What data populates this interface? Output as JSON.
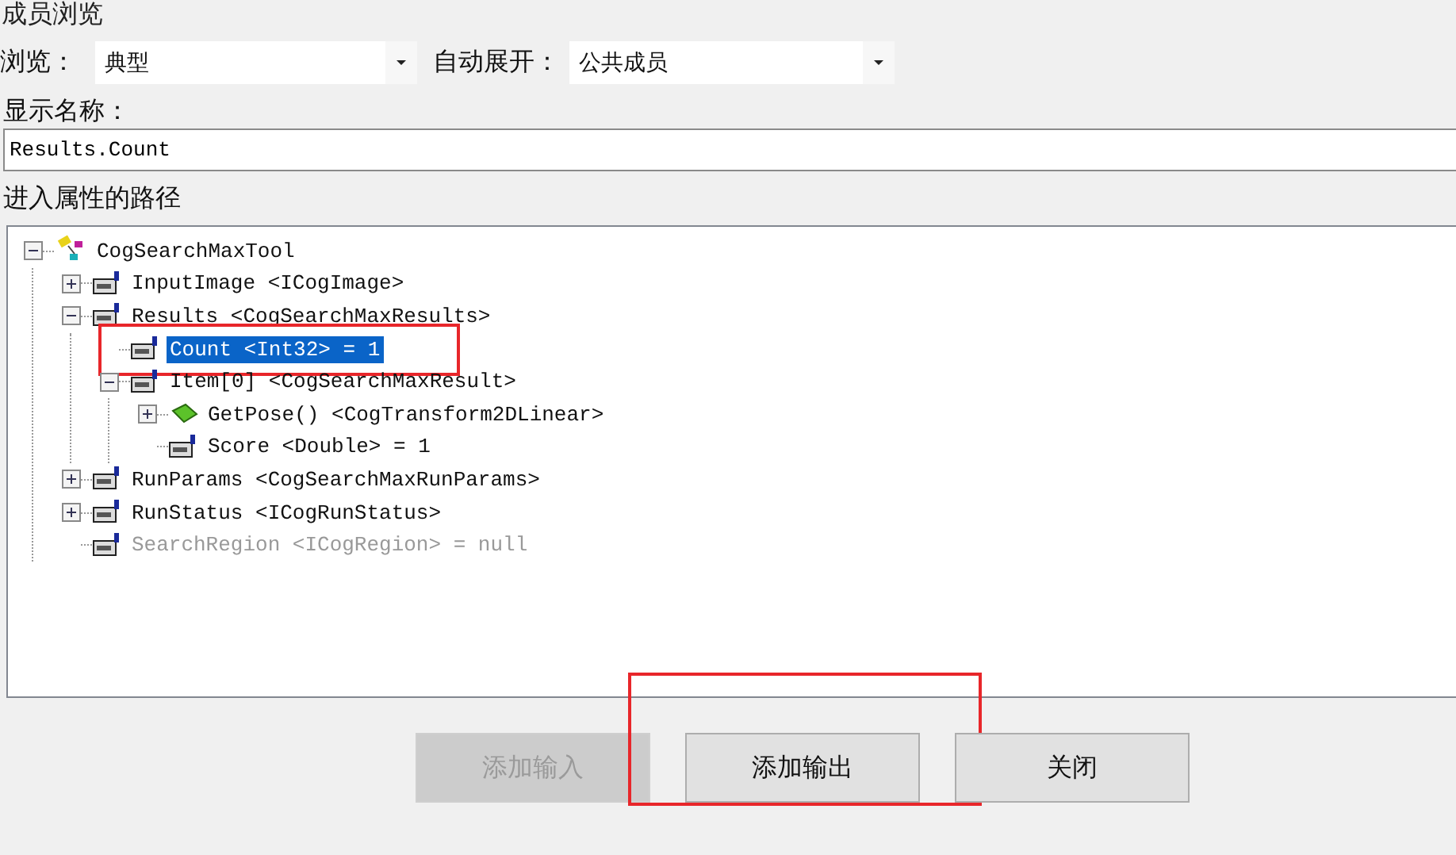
{
  "window": {
    "title": "成员浏览"
  },
  "browse": {
    "label": "浏览：",
    "value": "典型"
  },
  "auto_expand": {
    "label": "自动展开：",
    "value": "公共成员"
  },
  "display_name": {
    "label": "显示名称：",
    "value": "Results.Count"
  },
  "path_label": "进入属性的路径",
  "tree": [
    {
      "label": "CogSearchMaxTool",
      "kind": "tool",
      "expandable": true,
      "expanded": true,
      "selected": false,
      "disabled": false,
      "children": [
        {
          "label": "InputImage <ICogImage>",
          "kind": "property",
          "expandable": true,
          "expanded": false,
          "selected": false,
          "disabled": false
        },
        {
          "label": "Results <CogSearchMaxResults>",
          "kind": "property",
          "expandable": true,
          "expanded": true,
          "selected": false,
          "disabled": false,
          "children": [
            {
              "label": "Count <Int32> = 1",
              "kind": "property",
              "expandable": false,
              "expanded": false,
              "selected": true,
              "disabled": false,
              "annotated": true
            },
            {
              "label": "Item[0] <CogSearchMaxResult>",
              "kind": "property",
              "expandable": true,
              "expanded": true,
              "selected": false,
              "disabled": false,
              "children": [
                {
                  "label": "GetPose() <CogTransform2DLinear>",
                  "kind": "method",
                  "expandable": true,
                  "expanded": false,
                  "selected": false,
                  "disabled": false
                },
                {
                  "label": "Score <Double> = 1",
                  "kind": "property",
                  "expandable": false,
                  "expanded": false,
                  "selected": false,
                  "disabled": false
                }
              ]
            }
          ]
        },
        {
          "label": "RunParams <CogSearchMaxRunParams>",
          "kind": "property",
          "expandable": true,
          "expanded": false,
          "selected": false,
          "disabled": false
        },
        {
          "label": "RunStatus <ICogRunStatus>",
          "kind": "property",
          "expandable": true,
          "expanded": false,
          "selected": false,
          "disabled": false
        },
        {
          "label": "SearchRegion <ICogRegion> = null",
          "kind": "property",
          "expandable": false,
          "expanded": false,
          "selected": false,
          "disabled": true
        }
      ]
    }
  ],
  "buttons": [
    {
      "label": "添加输入",
      "disabled": true,
      "annotated": false
    },
    {
      "label": "添加输出",
      "disabled": false,
      "annotated": true
    },
    {
      "label": "关闭",
      "disabled": false,
      "annotated": false
    }
  ]
}
